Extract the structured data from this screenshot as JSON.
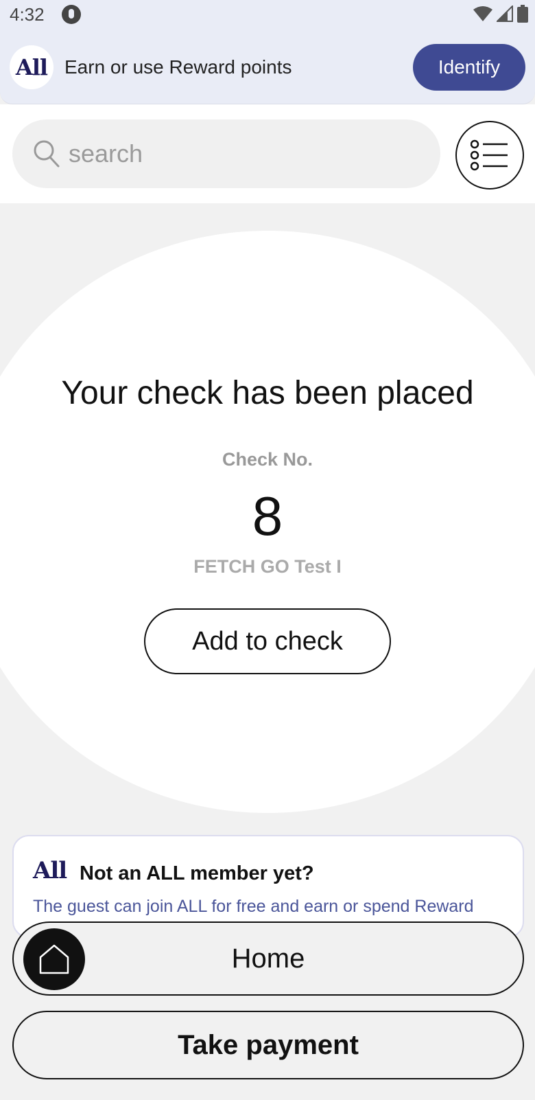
{
  "status_bar": {
    "time": "4:32",
    "icons": [
      "app-notification-icon",
      "wifi-icon",
      "signal-icon",
      "battery-icon"
    ]
  },
  "banner": {
    "brand": "All",
    "text": "Earn or use Reward points",
    "identify_label": "Identify",
    "accent_color": "#3f4a93"
  },
  "search": {
    "placeholder": "search"
  },
  "confirmation": {
    "title": "Your check has been placed",
    "check_label": "Check No.",
    "check_number": "8",
    "table_name": "FETCH GO Test  I",
    "add_label": "Add to check"
  },
  "member_card": {
    "logo": "All",
    "title": "Not an ALL member yet?",
    "description": "The guest can join ALL for free and earn or spend Reward"
  },
  "actions": {
    "home_label": "Home",
    "payment_label": "Take payment"
  }
}
